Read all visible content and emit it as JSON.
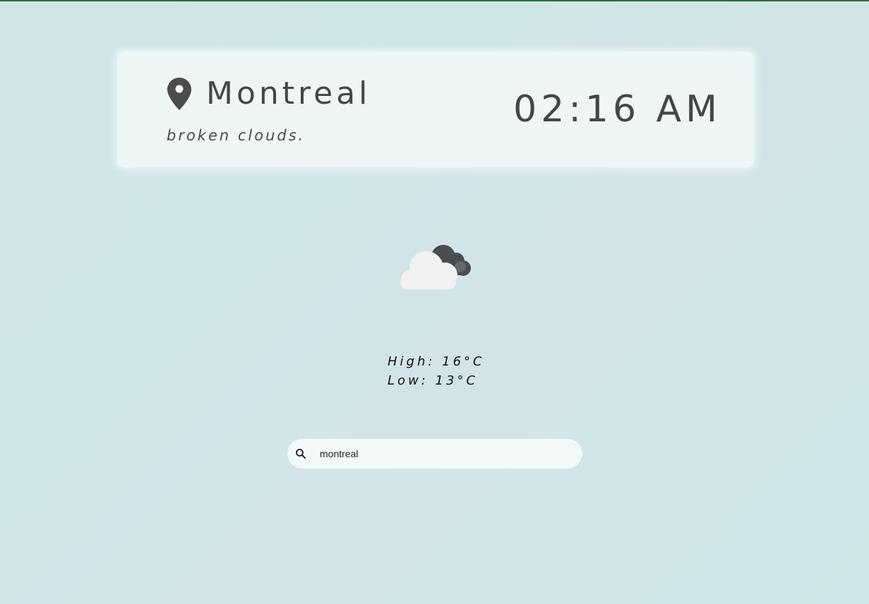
{
  "header": {
    "city": "Montreal",
    "condition": "broken clouds.",
    "time": "02:16 AM"
  },
  "weather": {
    "icon": "broken-clouds-night-icon",
    "high": "High: 16°C",
    "low": "Low: 13°C"
  },
  "search": {
    "value": "montreal",
    "icon": "search-icon"
  },
  "colors": {
    "text_dark": "#444748",
    "card_bg": "#f5faf9",
    "page_bg": "#d0e5e8",
    "top_border": "#2e6b3a"
  }
}
